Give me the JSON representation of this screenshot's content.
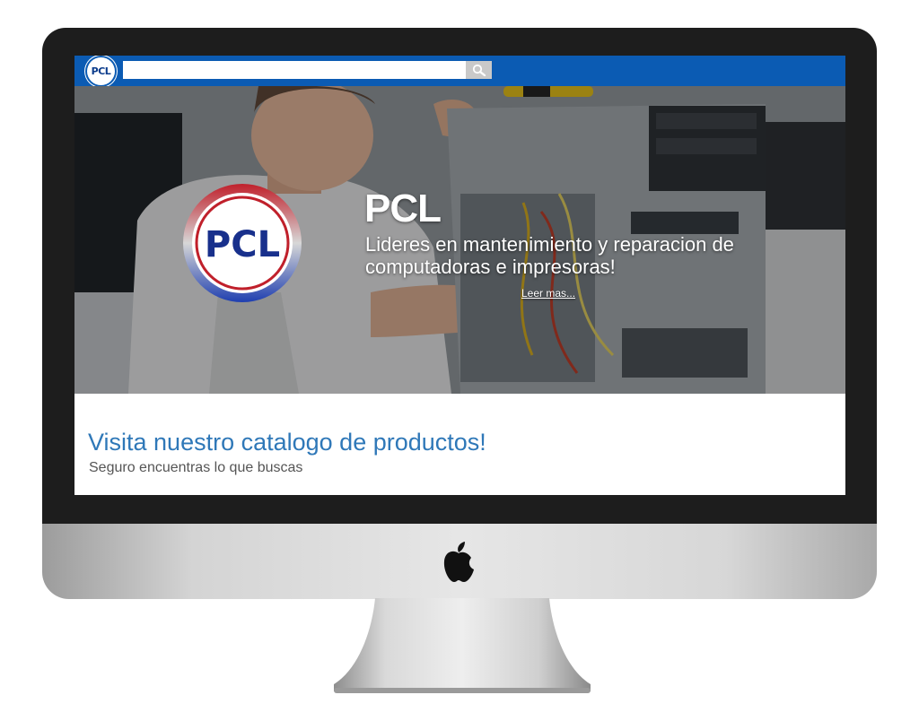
{
  "header": {
    "logo_text": "PCL",
    "search": {
      "value": "",
      "placeholder": ""
    },
    "search_icon": "search-icon"
  },
  "hero": {
    "title": "PCL",
    "tagline": "Lideres en mantenimiento y reparacion de computadoras e impresoras!",
    "link_label": "Leer mas...",
    "logo_text": "PCL"
  },
  "promo": {
    "title": "Visita nuestro catalogo de productos!",
    "subtitle": "Seguro encuentras lo que buscas"
  },
  "colors": {
    "topbar": "#0b5bb3",
    "promo_title": "#2f78b8",
    "logo_ring_red": "#c0202b",
    "logo_ring_blue": "#1f3fb0"
  },
  "device": {
    "brand_icon": "apple-icon"
  }
}
